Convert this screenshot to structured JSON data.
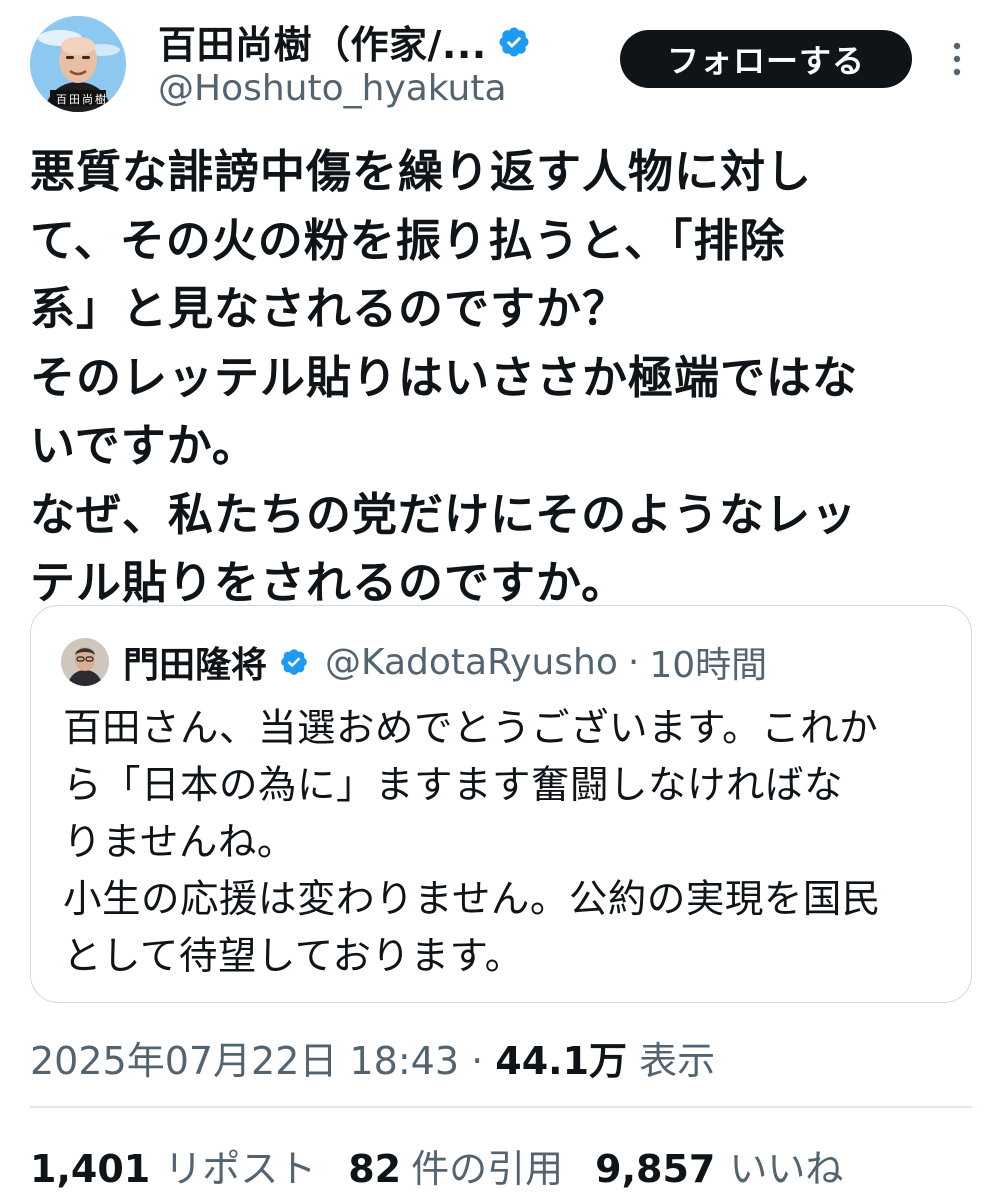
{
  "author": {
    "display_name": "百田尚樹（作家/...",
    "handle": "@Hoshuto_hyakuta",
    "verified": true,
    "avatar_caption": "百田尚樹"
  },
  "follow_label": "フォローする",
  "tweet": {
    "lines": [
      "悪質な誹謗中傷を繰り返す人物に対し",
      "て、その火の粉を振り払うと、「排除",
      "系」と見なされるのですか？",
      "そのレッテル貼りはいささか極端ではな",
      "いですか。",
      "なぜ、私たちの党だけにそのようなレッ",
      "テル貼りをされるのですか。"
    ]
  },
  "quote": {
    "display_name": "門田隆将",
    "handle": "@KadotaRyusho",
    "separator": "·",
    "time": "10時間",
    "lines": [
      "百田さん、当選おめでとうございます。これか",
      "ら「日本の為に」ますます奮闘しなければな",
      "りませんね。",
      "小生の応援は変わりません。公約の実現を国民",
      "として待望しております。"
    ]
  },
  "meta": {
    "timestamp": "2025年07月22日 18:43",
    "separator": "·",
    "views": "44.1万",
    "views_label": "表示"
  },
  "stats": {
    "reposts": "1,401",
    "reposts_label": "リポスト",
    "quotes": "82",
    "quotes_label": "件の引用",
    "likes": "9,857",
    "likes_label": "いいね"
  },
  "colors": {
    "text": "#0f1419",
    "secondary": "#536471",
    "verified": "#1d9bf0",
    "border": "#cfd9de",
    "follow_bg": "#0f1419"
  },
  "icons": {
    "verified": "verified-badge-icon",
    "more": "more-options-icon"
  }
}
